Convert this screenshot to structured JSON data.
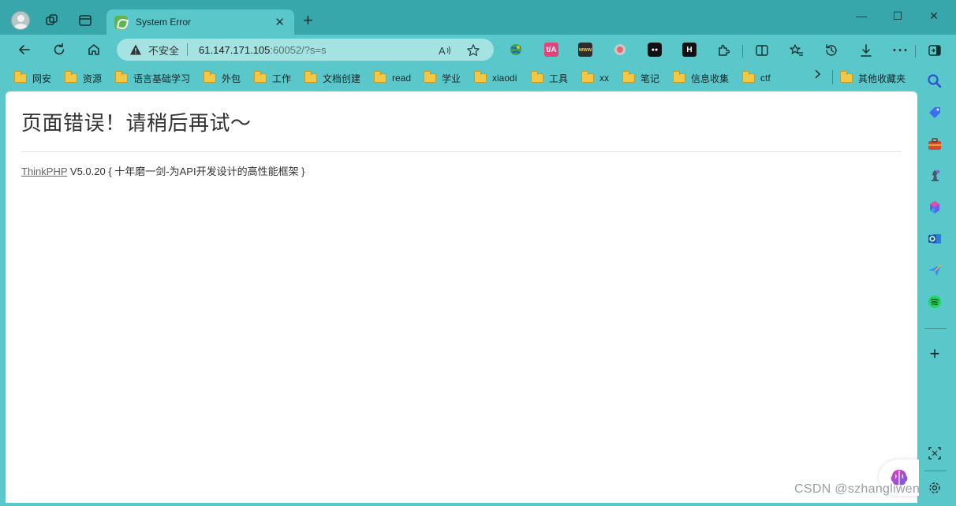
{
  "browser": {
    "tab": {
      "title": "System Error",
      "close": "✕"
    },
    "new_tab": "+",
    "window_controls": {
      "minimize": "—",
      "maximize": "☐",
      "close": "✕"
    }
  },
  "toolbar": {
    "security_label": "不安全",
    "url_host": "61.147.171.105",
    "url_rest": ":60052/?s=s",
    "read_aloud": "A",
    "more": "···"
  },
  "extensions": [
    {
      "name": "globe-extension-icon",
      "label": ""
    },
    {
      "name": "translate-extension-icon",
      "label": "t/A"
    },
    {
      "name": "www-extension-icon",
      "label": "www"
    },
    {
      "name": "circle-extension-icon",
      "label": ""
    },
    {
      "name": "sunglasses-extension-icon",
      "label": "●●"
    },
    {
      "name": "h-extension-icon",
      "label": "H"
    }
  ],
  "bookmarks": [
    "网安",
    "资源",
    "语言基础学习",
    "外包",
    "工作",
    "文档创建",
    "read",
    "学业",
    "xiaodi",
    "工具",
    "xx",
    "笔记",
    "信息收集",
    "ctf"
  ],
  "bookmarks_overflow": "其他收藏夹",
  "page": {
    "error_title": "页面错误！请稍后再试～",
    "framework_link": "ThinkPHP",
    "framework_info": " V5.0.20 { 十年磨一剑-为API开发设计的高性能框架 }"
  },
  "watermark": "CSDN @szhangliwenya",
  "sidebar": {
    "add": "+"
  },
  "colors": {
    "chrome": "#5ac8ca",
    "titlebar": "#38a7ab",
    "page": "#ffffff"
  }
}
